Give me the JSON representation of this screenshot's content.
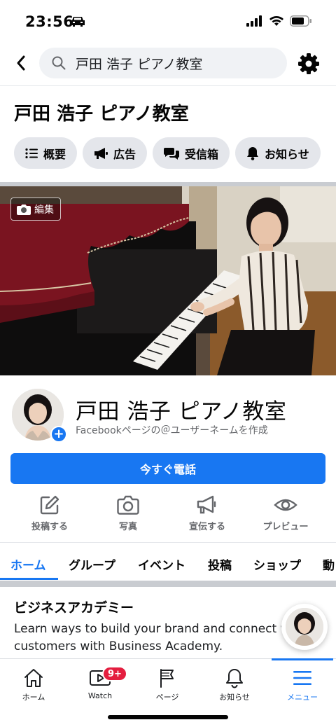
{
  "status_bar": {
    "time": "23:56"
  },
  "search": {
    "query": "戸田 浩子 ピアノ教室"
  },
  "page": {
    "heading": "戸田 浩子 ピアノ教室"
  },
  "chips": [
    {
      "label": "概要",
      "icon": "list-icon"
    },
    {
      "label": "広告",
      "icon": "megaphone-icon"
    },
    {
      "label": "受信箱",
      "icon": "chat-bubbles-icon"
    },
    {
      "label": "お知らせ",
      "icon": "bell-icon"
    }
  ],
  "cover": {
    "edit_label": "編集"
  },
  "profile": {
    "name": "戸田 浩子 ピアノ教室",
    "subtitle": "Facebookページの＠ユーザーネームを作成"
  },
  "cta": {
    "label": "今すぐ電話"
  },
  "actions": [
    {
      "label": "投稿する",
      "icon": "compose-icon"
    },
    {
      "label": "写真",
      "icon": "camera-icon"
    },
    {
      "label": "宣伝する",
      "icon": "megaphone-icon"
    },
    {
      "label": "プレビュー",
      "icon": "eye-icon"
    }
  ],
  "tabs": [
    "ホーム",
    "グループ",
    "イベント",
    "投稿",
    "ショップ",
    "動"
  ],
  "active_tab": "ホーム",
  "section": {
    "title": "ビジネスアカデミー",
    "body": "Learn ways to build your brand and connect with customers with Business Academy."
  },
  "bottom_nav": [
    {
      "label": "ホーム",
      "icon": "home-icon"
    },
    {
      "label": "Watch",
      "icon": "video-icon",
      "badge": "9+"
    },
    {
      "label": "ページ",
      "icon": "flag-icon"
    },
    {
      "label": "お知らせ",
      "icon": "bell-icon"
    },
    {
      "label": "メニュー",
      "icon": "hamburger-menu-icon",
      "active": true
    }
  ],
  "colors": {
    "brand": "#1877f2",
    "badge": "#e41e3f",
    "chip_bg": "#e4e6eb"
  }
}
